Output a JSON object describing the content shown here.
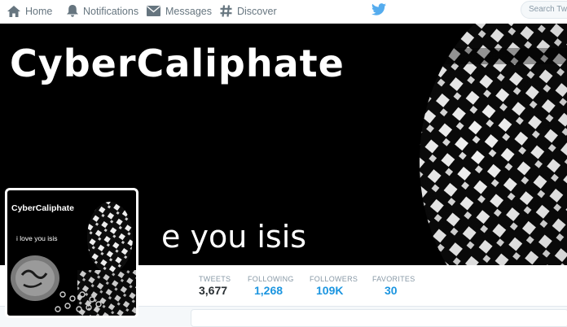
{
  "nav": {
    "home": {
      "label": "Home",
      "icon": "home-icon"
    },
    "notifications": {
      "label": "Notifications",
      "icon": "bell-icon"
    },
    "messages": {
      "label": "Messages",
      "icon": "envelope-icon"
    },
    "discover": {
      "label": "Discover",
      "icon": "hashtag-icon"
    }
  },
  "logo_icon": "twitter-bird-icon",
  "search": {
    "placeholder": "Search Twitter"
  },
  "banner": {
    "title": "CyberCaliphate",
    "subtitle": "e you isis"
  },
  "avatar": {
    "title": "CyberCaliphate",
    "subtitle": "i love you isis"
  },
  "stats": [
    {
      "label": "TWEETS",
      "value": "3,677"
    },
    {
      "label": "FOLLOWING",
      "value": "1,268"
    },
    {
      "label": "FOLLOWERS",
      "value": "109K"
    },
    {
      "label": "FAVORITES",
      "value": "30"
    }
  ],
  "colors": {
    "accent": "#55acee",
    "link": "#1b95e0",
    "nav_text": "#66757f"
  }
}
